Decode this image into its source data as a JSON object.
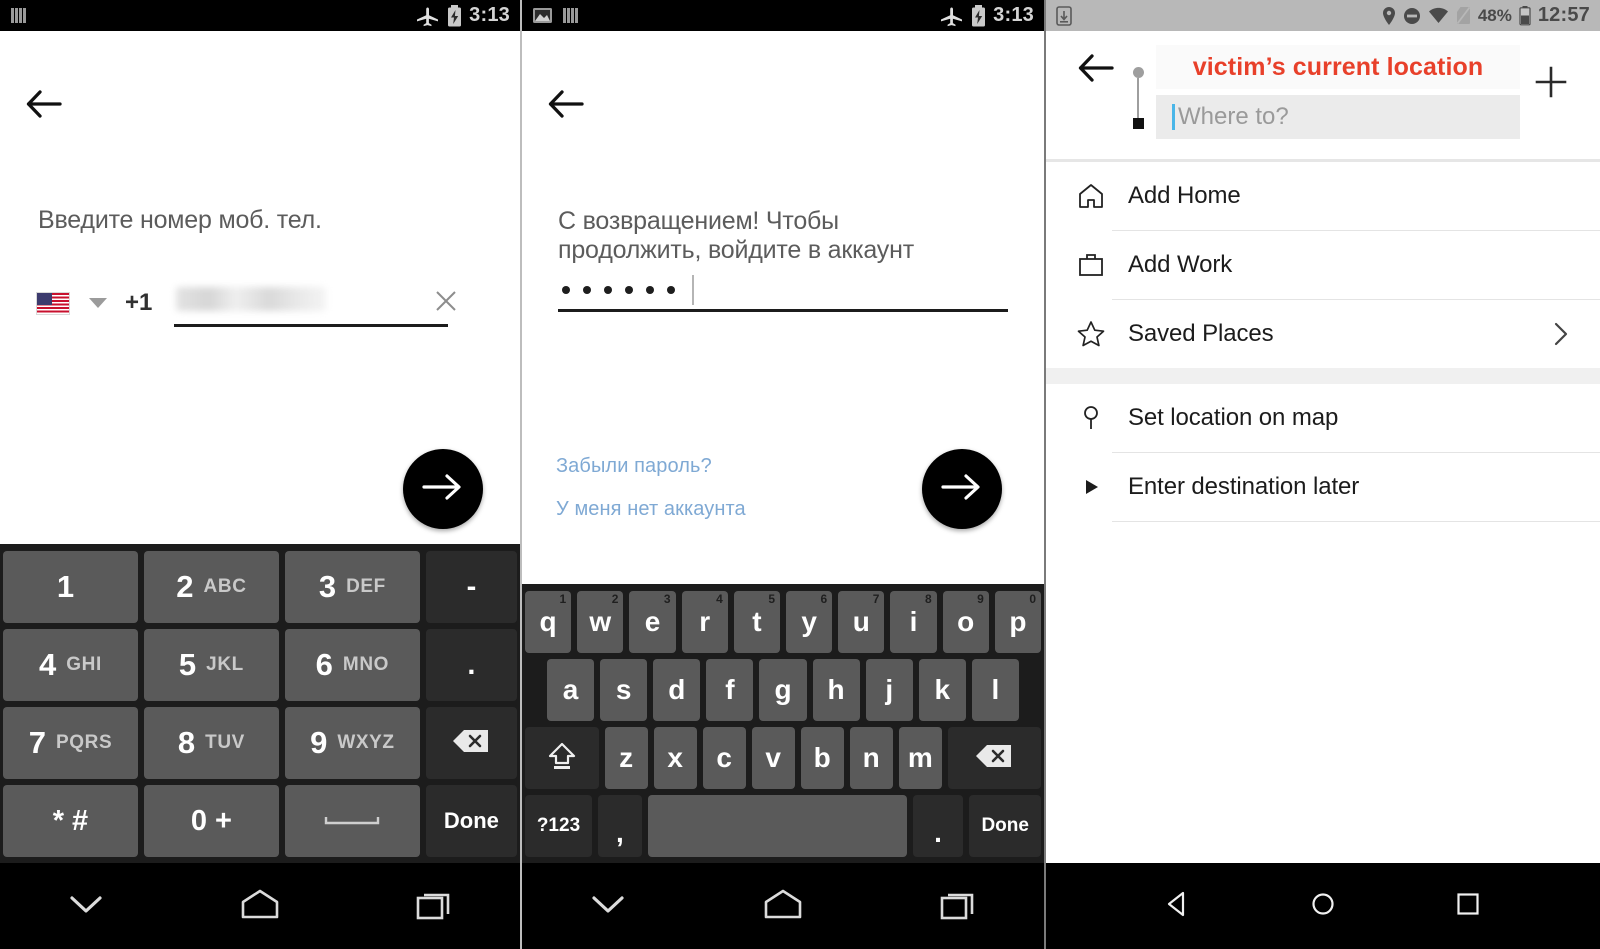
{
  "screens": [
    {
      "id": "phone-entry",
      "statusbar": {
        "left_icons": [
          "bars-icon"
        ],
        "right_icons": [
          "airplane-mode-icon",
          "battery-charging-icon"
        ],
        "time": "3:13"
      },
      "back_icon": "back-arrow-icon",
      "prompt": "Введите номер моб. тел.",
      "phone": {
        "flag_icon": "us-flag-icon",
        "dropdown_icon": "caret-down-icon",
        "country_code": "+1",
        "value": "",
        "redacted": true,
        "clear_icon": "close-icon"
      },
      "submit_icon": "arrow-right-icon",
      "keyboard": {
        "type": "numeric",
        "rows": [
          [
            {
              "num": "1",
              "alpha": "",
              "style": "light"
            },
            {
              "num": "2",
              "alpha": "ABC",
              "style": "light"
            },
            {
              "num": "3",
              "alpha": "DEF",
              "style": "light"
            },
            {
              "num": "-",
              "alpha": "",
              "style": "dark",
              "kind": "sym"
            }
          ],
          [
            {
              "num": "4",
              "alpha": "GHI",
              "style": "light"
            },
            {
              "num": "5",
              "alpha": "JKL",
              "style": "light"
            },
            {
              "num": "6",
              "alpha": "MNO",
              "style": "light"
            },
            {
              "num": ".",
              "alpha": "",
              "style": "dark",
              "kind": "sym"
            }
          ],
          [
            {
              "num": "7",
              "alpha": "PQRS",
              "style": "light"
            },
            {
              "num": "8",
              "alpha": "TUV",
              "style": "light"
            },
            {
              "num": "9",
              "alpha": "WXYZ",
              "style": "light"
            },
            {
              "num": "",
              "alpha": "",
              "style": "dark",
              "kind": "backspace",
              "icon": "backspace-icon"
            }
          ],
          [
            {
              "num": "* #",
              "alpha": "",
              "style": "light",
              "kind": "sym"
            },
            {
              "num": "0 +",
              "alpha": "",
              "style": "light",
              "kind": "sym"
            },
            {
              "num": "",
              "alpha": "",
              "style": "light",
              "kind": "space",
              "icon": "space-icon"
            },
            {
              "num": "Done",
              "alpha": "",
              "style": "dark",
              "kind": "done"
            }
          ]
        ]
      },
      "navbar": [
        "chevron-down-icon",
        "home-icon",
        "recents-icon"
      ]
    },
    {
      "id": "password-entry",
      "statusbar": {
        "left_icons": [
          "screenshot-icon",
          "bars-icon"
        ],
        "right_icons": [
          "airplane-mode-icon",
          "battery-charging-icon"
        ],
        "time": "3:13"
      },
      "back_icon": "back-arrow-icon",
      "prompt": "С возвращением! Чтобы\nпродолжить, войдите в аккаунт",
      "password": {
        "masked_value": "••••••",
        "dot_count": 6
      },
      "links": [
        "Забыли пароль?",
        "У меня нет аккаунта"
      ],
      "submit_icon": "arrow-right-icon",
      "keyboard": {
        "type": "qwerty",
        "row1": [
          {
            "k": "q",
            "sup": "1"
          },
          {
            "k": "w",
            "sup": "2"
          },
          {
            "k": "e",
            "sup": "3"
          },
          {
            "k": "r",
            "sup": "4"
          },
          {
            "k": "t",
            "sup": "5"
          },
          {
            "k": "y",
            "sup": "6"
          },
          {
            "k": "u",
            "sup": "7"
          },
          {
            "k": "i",
            "sup": "8"
          },
          {
            "k": "o",
            "sup": "9"
          },
          {
            "k": "p",
            "sup": "0"
          }
        ],
        "row2": [
          {
            "k": "a"
          },
          {
            "k": "s"
          },
          {
            "k": "d"
          },
          {
            "k": "f"
          },
          {
            "k": "g"
          },
          {
            "k": "h"
          },
          {
            "k": "j"
          },
          {
            "k": "k"
          },
          {
            "k": "l"
          }
        ],
        "row3_shift": "shift-icon",
        "row3": [
          {
            "k": "z"
          },
          {
            "k": "x"
          },
          {
            "k": "c"
          },
          {
            "k": "v"
          },
          {
            "k": "b"
          },
          {
            "k": "n"
          },
          {
            "k": "m"
          }
        ],
        "row3_backspace": "backspace-icon",
        "row4": {
          "symbols": "?123",
          "comma": ",",
          "space": "",
          "period": ".",
          "done": "Done"
        }
      },
      "navbar": [
        "chevron-down-icon",
        "home-icon",
        "recents-icon"
      ]
    },
    {
      "id": "destination-picker",
      "statusbar": {
        "left_icons": [
          "download-icon"
        ],
        "right_icons": [
          "location-icon",
          "do-not-disturb-icon",
          "wifi-icon",
          "no-sim-icon"
        ],
        "battery_percent": "48%",
        "time": "12:57"
      },
      "back_icon": "back-arrow-icon",
      "route": {
        "origin_marker": "origin-dot-icon",
        "dest_marker": "destination-square-icon",
        "origin_value": "victim’s current location",
        "origin_color": "#e8402a",
        "destination_placeholder": "Where to?"
      },
      "add_stop_icon": "plus-icon",
      "list": [
        {
          "icon": "home-icon",
          "label": "Add Home",
          "chevron": false
        },
        {
          "icon": "briefcase-icon",
          "label": "Add Work",
          "chevron": false
        },
        {
          "icon": "star-icon",
          "label": "Saved Places",
          "chevron": true
        }
      ],
      "list2": [
        {
          "icon": "map-pin-icon",
          "label": "Set location on map",
          "chevron": false
        },
        {
          "icon": "play-triangle-icon",
          "label": "Enter destination later",
          "chevron": false
        }
      ],
      "navbar": [
        "nav-back-icon",
        "nav-home-icon",
        "nav-recents-icon"
      ]
    }
  ]
}
